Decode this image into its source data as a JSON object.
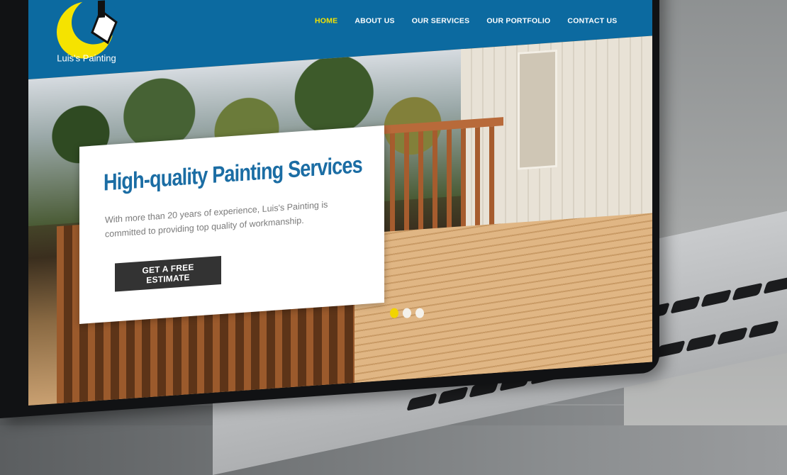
{
  "brand": {
    "name": "Luis's Painting",
    "logo_icon": "paint-brush-moon-icon",
    "colors": {
      "primary": "#0c6aa0",
      "accent": "#f5e300",
      "dark": "#333333"
    }
  },
  "nav": {
    "items": [
      {
        "label": "HOME",
        "active": true
      },
      {
        "label": "ABOUT US",
        "active": false
      },
      {
        "label": "OUR SERVICES",
        "active": false
      },
      {
        "label": "OUR PORTFOLIO",
        "active": false
      },
      {
        "label": "CONTACT US",
        "active": false
      }
    ]
  },
  "hero": {
    "title": "High-quality Painting Services",
    "text": "With more than 20 years of experience, Luis's Painting is committed to providing top quality of workmanship.",
    "cta_label": "GET A FREE ESTIMATE",
    "slides": {
      "count": 3,
      "active_index": 0
    }
  }
}
